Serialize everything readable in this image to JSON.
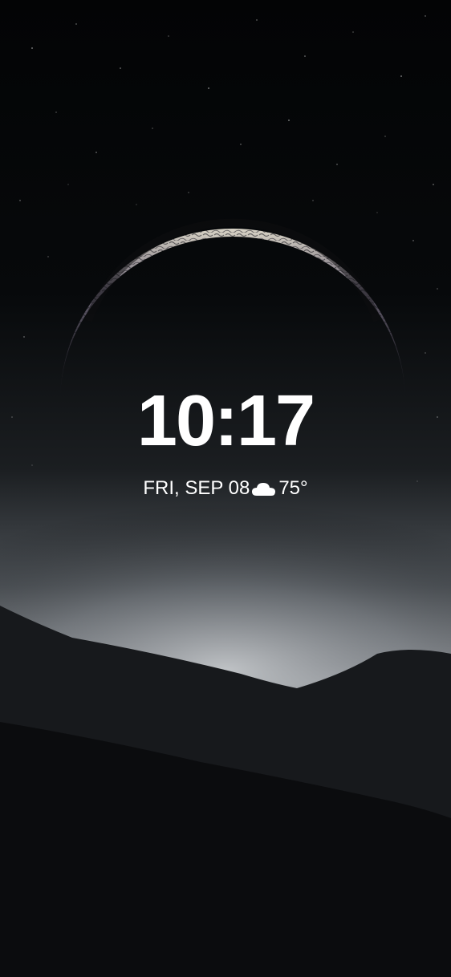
{
  "lock_screen": {
    "time": "10:17",
    "date": "FRI, SEP 08",
    "weather": {
      "icon": "cloud-icon",
      "temperature": "75°"
    }
  }
}
